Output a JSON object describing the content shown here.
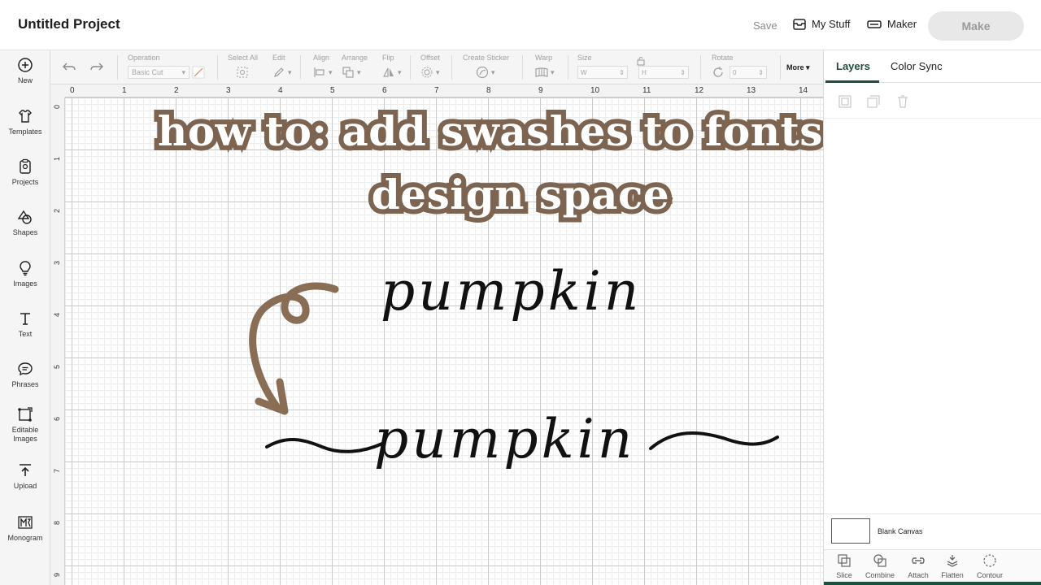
{
  "header": {
    "project_title": "Untitled Project",
    "save_label": "Save",
    "my_stuff_label": "My Stuff",
    "maker_label": "Maker",
    "make_label": "Make"
  },
  "sidebar": {
    "items": [
      {
        "label": "New",
        "icon": "plus-circle-icon"
      },
      {
        "label": "Templates",
        "icon": "shirt-icon"
      },
      {
        "label": "Projects",
        "icon": "clipboard-icon"
      },
      {
        "label": "Shapes",
        "icon": "shapes-icon"
      },
      {
        "label": "Images",
        "icon": "bulb-icon"
      },
      {
        "label": "Text",
        "icon": "text-t-icon"
      },
      {
        "label": "Phrases",
        "icon": "speech-bubble-icon"
      },
      {
        "label": "Editable Images",
        "icon": "edit-image-icon"
      },
      {
        "label": "Upload",
        "icon": "upload-icon"
      },
      {
        "label": "Monogram",
        "icon": "monogram-icon"
      }
    ]
  },
  "toolbar": {
    "operation_label": "Operation",
    "operation_value": "Basic Cut",
    "select_all_label": "Select All",
    "edit_label": "Edit",
    "align_label": "Align",
    "arrange_label": "Arrange",
    "flip_label": "Flip",
    "offset_label": "Offset",
    "create_sticker_label": "Create Sticker",
    "warp_label": "Warp",
    "size_label": "Size",
    "size_w_label": "W",
    "size_h_label": "H",
    "rotate_label": "Rotate",
    "rotate_value": "0",
    "more_label": "More"
  },
  "canvas": {
    "ruler_top": [
      "0",
      "1",
      "2",
      "3",
      "4",
      "5",
      "6",
      "7",
      "8",
      "9",
      "10",
      "11",
      "12",
      "13",
      "14"
    ],
    "ruler_left": [
      "0",
      "1",
      "2",
      "3",
      "4",
      "5",
      "6",
      "7",
      "8",
      "9"
    ],
    "overlay_line_1": "how to: add swashes to fonts in",
    "overlay_line_2": "design space",
    "word_top": "pumpkin",
    "word_bottom": "pumpkin"
  },
  "right_panel": {
    "tab_layers": "Layers",
    "tab_color_sync": "Color Sync",
    "blank_canvas_label": "Blank Canvas",
    "bottom_tools": [
      "Slice",
      "Combine",
      "Attach",
      "Flatten",
      "Contour"
    ]
  },
  "colors": {
    "brand_green": "#1c4e3b",
    "overlay_outline": "#7d6450",
    "arrow_brown": "#8a6d55"
  }
}
